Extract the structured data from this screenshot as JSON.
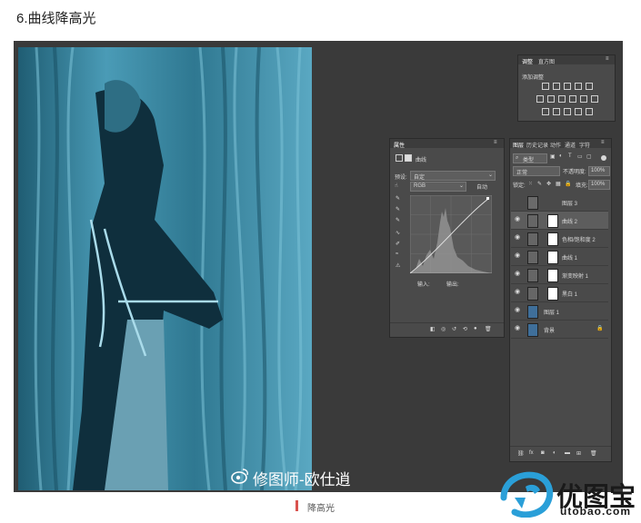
{
  "article": {
    "step_title": "6.曲线降高光",
    "caption": "降高光",
    "watermark": "修图师-欧仕逍",
    "logo_text": "优图宝",
    "logo_url": "utobao.com"
  },
  "panels": {
    "adjustments": {
      "tabs": [
        "调整",
        "直方图"
      ],
      "title": "添加调整"
    },
    "properties": {
      "title": "属性",
      "subtitle": "曲线",
      "preset_label": "预设:",
      "preset_value": "自定",
      "channel_value": "RGB",
      "auto_button": "自动",
      "input_label": "输入:",
      "output_label": "输出:"
    },
    "layers": {
      "tabs": [
        "图层",
        "历史记录",
        "动作",
        "通道",
        "字符"
      ],
      "kind_value": "类型",
      "blend_mode": "正常",
      "opacity_label": "不透明度:",
      "opacity_value": "100%",
      "lock_label": "锁定:",
      "fill_label": "填充:",
      "fill_value": "100%",
      "items": [
        {
          "name": "图层 3",
          "type": "layer"
        },
        {
          "name": "曲线 2",
          "type": "curves"
        },
        {
          "name": "色相/饱和度 2",
          "type": "hue"
        },
        {
          "name": "曲线 1",
          "type": "curves"
        },
        {
          "name": "渐变映射 1",
          "type": "gradient"
        },
        {
          "name": "黑白 1",
          "type": "bw"
        },
        {
          "name": "图层 1",
          "type": "photo"
        },
        {
          "name": "背景",
          "type": "photo"
        }
      ]
    }
  },
  "colors": {
    "photo_tint": "#3f8aa3",
    "ps_bg": "#3a3a3a",
    "panel": "#4a4a4a",
    "accent_red": "#d9534f",
    "logo_blue": "#2a9fd8"
  }
}
